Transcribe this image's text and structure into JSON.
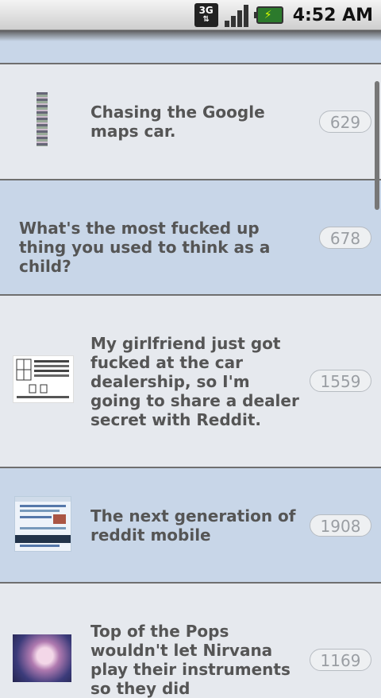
{
  "status": {
    "network": "3G",
    "time": "4:52 AM"
  },
  "posts": [
    {
      "title": "Chasing the Google maps car.",
      "score": "629"
    },
    {
      "title": "What's the most fucked up thing you used to think as a child?",
      "score": "678"
    },
    {
      "title": "My girlfriend just got fucked at the car dealership, so I'm going to share a dealer secret with Reddit.",
      "score": "1559"
    },
    {
      "title": "The next generation of reddit mobile",
      "score": "1908"
    },
    {
      "title": "Top of the Pops wouldn't let Nirvana play their instruments so they did",
      "score": "1169"
    }
  ]
}
